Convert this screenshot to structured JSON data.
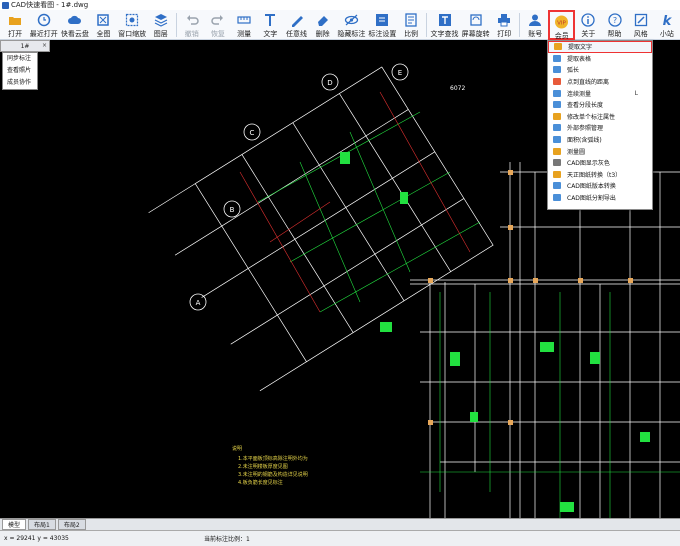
{
  "window": {
    "title": "CAD快速看图 - 1#.dwg"
  },
  "toolbar": {
    "buttons": [
      {
        "label": "打开",
        "icon": "folder-open-icon",
        "color": "#e8a21f"
      },
      {
        "label": "最近打开",
        "icon": "recent-clock-icon",
        "color": "#2f6fc6"
      },
      {
        "label": "快看云盘",
        "icon": "cloud-icon",
        "color": "#2f6fc6"
      },
      {
        "label": "全图",
        "icon": "fullview-icon",
        "color": "#2f6fc6"
      },
      {
        "label": "窗口缩放",
        "icon": "window-zoom-icon",
        "color": "#2f6fc6"
      },
      {
        "label": "图层",
        "icon": "layers-icon",
        "color": "#2f6fc6"
      },
      {
        "label": "撤销",
        "icon": "undo-icon",
        "color": "#9aa3ad"
      },
      {
        "label": "恢复",
        "icon": "redo-icon",
        "color": "#9aa3ad"
      },
      {
        "label": "测量",
        "icon": "measure-icon",
        "color": "#2f6fc6"
      },
      {
        "label": "文字",
        "icon": "text-icon",
        "color": "#2f6fc6"
      },
      {
        "label": "任意线",
        "icon": "freeline-icon",
        "color": "#2f6fc6"
      },
      {
        "label": "删除",
        "icon": "eraser-icon",
        "color": "#2f6fc6"
      },
      {
        "label": "隐藏标注",
        "icon": "hide-eye-icon",
        "color": "#2f6fc6"
      },
      {
        "label": "标注设置",
        "icon": "annotation-settings-icon",
        "color": "#2f6fc6"
      },
      {
        "label": "比例",
        "icon": "scale-icon",
        "color": "#2f6fc6"
      },
      {
        "label": "文字查找",
        "icon": "text-search-icon",
        "color": "#2f6fc6"
      },
      {
        "label": "屏幕旋转",
        "icon": "rotate-icon",
        "color": "#2f6fc6"
      },
      {
        "label": "打印",
        "icon": "print-icon",
        "color": "#2f6fc6"
      },
      {
        "label": "账号",
        "icon": "user-icon",
        "color": "#2f6fc6"
      },
      {
        "label": "会员",
        "icon": "vip-icon",
        "color": "#e0a31a"
      },
      {
        "label": "关于",
        "icon": "info-icon",
        "color": "#2f6fc6"
      },
      {
        "label": "帮助",
        "icon": "help-icon",
        "color": "#2f6fc6"
      },
      {
        "label": "风格",
        "icon": "style-icon",
        "color": "#2f6fc6"
      },
      {
        "label": "小站",
        "icon": "k-station-icon",
        "color": "#2f6fc6"
      }
    ]
  },
  "doc_tab": {
    "label": "1#"
  },
  "side_menu": {
    "items": [
      "同步标注",
      "查看照片",
      "成员协作"
    ]
  },
  "dropdown": {
    "items": [
      {
        "label": "提取文字",
        "icon": "extract-text-icon",
        "color": "#e8a21f",
        "active": true
      },
      {
        "label": "提取表格",
        "icon": "extract-table-icon",
        "color": "#4a8fd8"
      },
      {
        "label": "弧长",
        "icon": "arc-length-icon",
        "color": "#4a8fd8"
      },
      {
        "label": "点到直线的距离",
        "icon": "point-line-distance-icon",
        "color": "#e85a3a"
      },
      {
        "label": "连续测量",
        "icon": "continuous-measure-icon",
        "color": "#4a8fd8",
        "shortcut": "L"
      },
      {
        "label": "查看分段长度",
        "icon": "segment-length-icon",
        "color": "#4a8fd8"
      },
      {
        "label": "修改单个标注属性",
        "icon": "edit-annotation-icon",
        "color": "#e8a21f"
      },
      {
        "label": "外部参照管理",
        "icon": "xref-icon",
        "color": "#4a8fd8"
      },
      {
        "label": "面积(含弧线)",
        "icon": "area-arc-icon",
        "color": "#4a8fd8"
      },
      {
        "label": "测量圆",
        "icon": "measure-circle-icon",
        "color": "#e8a21f"
      },
      {
        "label": "CAD图显示灰色",
        "icon": "gray-display-icon",
        "color": "#777777"
      },
      {
        "label": "天正图纸转换（t3）",
        "icon": "tangent-convert-icon",
        "color": "#e8a21f"
      },
      {
        "label": "CAD图纸版本转换",
        "icon": "version-convert-icon",
        "color": "#4a8fd8"
      },
      {
        "label": "CAD图纸分割导出",
        "icon": "split-export-icon",
        "color": "#4a8fd8"
      }
    ]
  },
  "canvas": {
    "axis_bubbles": [
      "A",
      "B",
      "C",
      "D",
      "E"
    ],
    "notes_title": "说明",
    "notes_lines": [
      "1.本平面板顶标高除注明外均为",
      "2.未注明楼板厚度见图",
      "3.未注明的钢筋及构造详见说明",
      "4.板负筋长度见标注"
    ],
    "dimension_label": "6072"
  },
  "layout_tabs": [
    "模型",
    "布局1",
    "布局2"
  ],
  "status": {
    "coords": "x = 29241  y = 43035",
    "scale": "当前标注比例：1"
  },
  "colors": {
    "accent_red": "#e33333",
    "cad_white": "#ffffff",
    "cad_green": "#22e040",
    "cad_red": "#e03030",
    "cad_cyan": "#40d8e8"
  }
}
